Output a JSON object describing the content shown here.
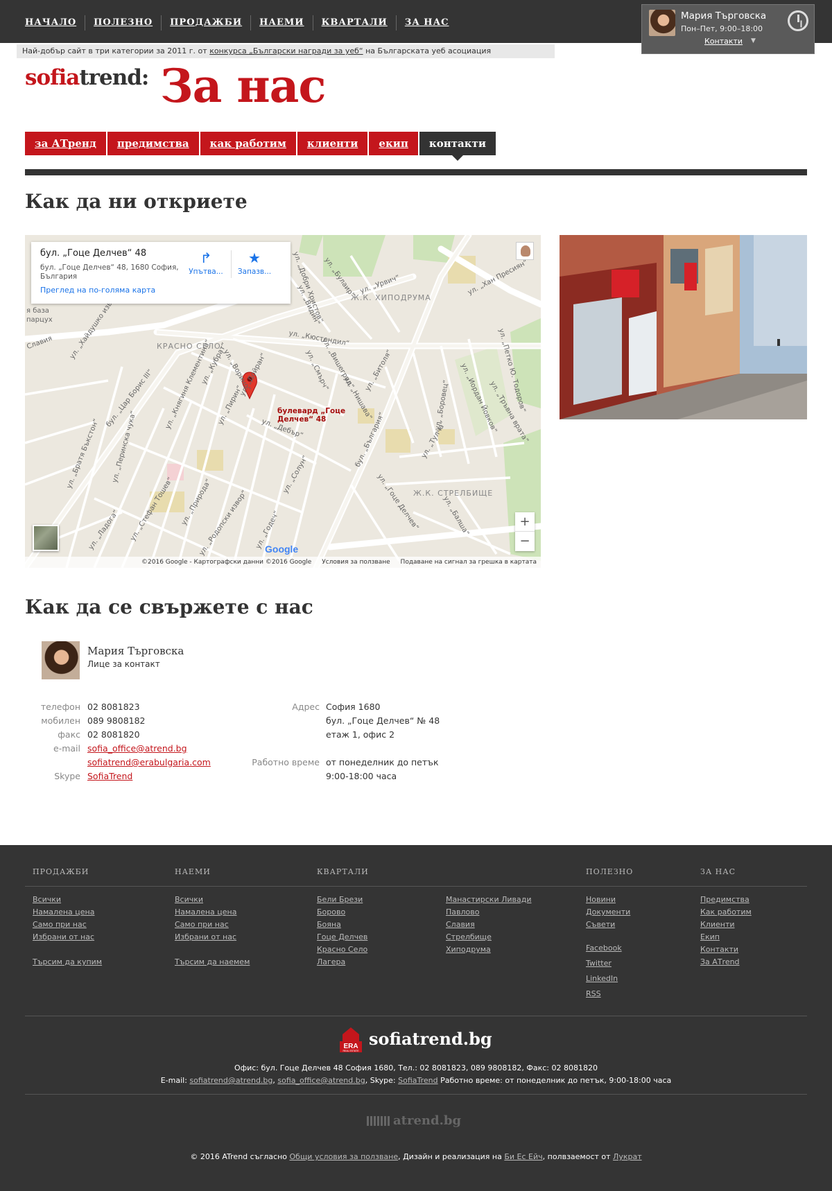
{
  "topnav": [
    "НАЧАЛО",
    "ПОЛЕЗНО",
    "ПРОДАЖБИ",
    "НАЕМИ",
    "КВАРТАЛИ",
    "ЗА НАС"
  ],
  "contact_box": {
    "name": "Мария Търговска",
    "hours": "Пон–Пет, 9:00–18:00",
    "link": "Контакти",
    "chevron": "▼"
  },
  "award": {
    "prefix": "Най-добър сайт в три категории за 2011 г. от ",
    "link": "конкурса „Български награди за уеб“",
    "suffix": " на Българската уеб асоциация"
  },
  "logo": {
    "part1": "sofia",
    "part2": "trend:"
  },
  "page_title": "За нас",
  "tabs": [
    "за АТренд",
    "предимства",
    "как работим",
    "клиенти",
    "екип",
    "контакти"
  ],
  "active_tab": "контакти",
  "section1_title": "Как да ни откриете",
  "map": {
    "card_title": "бул. „Гоце Делчев“ 48",
    "card_address": "бул. „Гоце Делчев“ 48, 1680 София, България",
    "card_link": "Преглед на по-голяма карта",
    "directions": "Упътва...",
    "save": "Запазв...",
    "directions_icon": "↱",
    "save_icon": "★",
    "pin_label": "булевард „Гоце Делчев“ 48",
    "zoom_in": "+",
    "zoom_out": "−",
    "brand": "Google",
    "footer": [
      "©2016 Google - Картографски данни ©2016 Google",
      "Условия за ползване",
      "Подаване на сигнал за грешка в картата"
    ],
    "districts": [
      "КРАСНО СЕЛО",
      "Ж.К. ХИПОДРУМА",
      "Ж.К. СТРЕЛБИЩЕ"
    ],
    "streets": [
      "бул. „Цар Борис III“",
      "ул. „Дойран“",
      "ул. „Нишава“",
      "ул. „Битоля“",
      "ул. „Кюстендил“",
      "ул. „Вишеград“",
      "ул. „Смърч“",
      "ул. „Дебър“",
      "ул. „Солун“",
      "ул. „Тулча“",
      "ул. „Боровец“",
      "ул. „Ладога“",
      "ул. „Природа“",
      "ул. „Пирин“",
      "ул. „Хайдушко изворче“",
      "ул. „Булаир“",
      "ул. „Урвич“",
      "ул. „Хан Пресиян“",
      "ул. „Иордан Йовков“",
      "ул. „Тръвна врата“",
      "ул. „Петко Ю. Тодоров“",
      "бул. „България“",
      "ул. „Кубрат“",
      "ул. „Княгиня Клементина“",
      "ул. „Братя Бъкстон“",
      "ул. „Перинска чука“",
      "ул. „Стефан Тошев“",
      "ул. „Родопски извор“",
      "ул. „Годеч“",
      "ул. „Ворино“",
      "ул. „Добри Христов“",
      "ул. „Видин“",
      "ул. „Гоце Делчев“",
      "ул. „Балшa“"
    ],
    "left_fragment_1": "я база",
    "left_fragment_2": "парцух",
    "left_fragment_3": "Славия"
  },
  "section2_title": "Как да се свържете с нас",
  "person": {
    "name": "Мария Търговска",
    "role": "Лице за контакт"
  },
  "contacts_left": [
    {
      "k": "телефон",
      "v": "02 8081823",
      "link": false
    },
    {
      "k": "мобилен",
      "v": "089 9808182",
      "link": false
    },
    {
      "k": "факс",
      "v": "02 8081820",
      "link": false
    },
    {
      "k": "e-mail",
      "v": "sofia_office@atrend.bg",
      "link": true
    },
    {
      "k": "",
      "v": "sofiatrend@erabulgaria.com",
      "link": true
    },
    {
      "k": "Skype",
      "v": "SofiaTrend",
      "link": true
    }
  ],
  "contacts_right": [
    {
      "k": "Адрес",
      "v": "София 1680"
    },
    {
      "k": "",
      "v": "бул. „Гоце Делчев“ № 48"
    },
    {
      "k": "",
      "v": "етаж 1, офис 2"
    },
    {
      "k": "Работно време",
      "v": "от понеделник до петък"
    },
    {
      "k": "",
      "v": "9:00-18:00 часа"
    }
  ],
  "footer": {
    "headings": [
      "ПРОДАЖБИ",
      "НАЕМИ",
      "КВАРТАЛИ",
      "ПОЛЕЗНО",
      "ЗА НАС"
    ],
    "sales": [
      "Всички",
      "Намалена цена",
      "Само при нас",
      "Избрани от нас"
    ],
    "sales_extra": "Търсим да купим",
    "rent": [
      "Всички",
      "Намалена цена",
      "Само при нас",
      "Избрани от нас"
    ],
    "rent_extra": "Търсим да наемем",
    "districts_a": [
      "Бели Брези",
      "Борово",
      "Бояна",
      "Гоце Делчев",
      "Красно Село",
      "Лагера"
    ],
    "districts_b": [
      "Манастирски Ливади",
      "Павлово",
      "Славия",
      "Стрелбище",
      "Хиподрума"
    ],
    "useful": [
      "Новини",
      "Документи",
      "Съвети"
    ],
    "social": [
      {
        "label": "Facebook",
        "color": "#3b5998"
      },
      {
        "label": "Twitter",
        "color": "#55acee"
      },
      {
        "label": "LinkedIn",
        "color": "#0077b5"
      },
      {
        "label": "RSS",
        "color": "#f26522"
      }
    ],
    "about": [
      "Предимства",
      "Как работим",
      "Клиенти",
      "Екип",
      "Контакти",
      "За АТrend"
    ],
    "brand": "sofiatrend.bg",
    "era": "ERA",
    "era_sub": "REAL ESTATE",
    "office_line": "Офис: бул. Гоце Делчев 48 София 1680, Тел.: 02 8081823, 089 9808182, Факс: 02 8081820",
    "email_label": "E-mail: ",
    "email1": "sofiatrend@atrend.bg",
    "email2": "sofia_office@atrend.bg",
    "skype_label": ", Skype: ",
    "skype": "SofiaTrend",
    "hours_text": " Работно време: от понеделник до петък, 9:00-18:00 часа",
    "atrend": "atrend.bg",
    "copy_prefix": "© 2016 ATrend съгласно ",
    "copy_terms": "Общи условия за ползване",
    "copy_mid": ", Дизайн и реализация на ",
    "copy_design": "Би Ес Ейч",
    "copy_mid2": ", полвзаемост от ",
    "copy_host": "Лукрат"
  },
  "colors": {
    "brand_red": "#c4161c",
    "dark": "#343434"
  }
}
